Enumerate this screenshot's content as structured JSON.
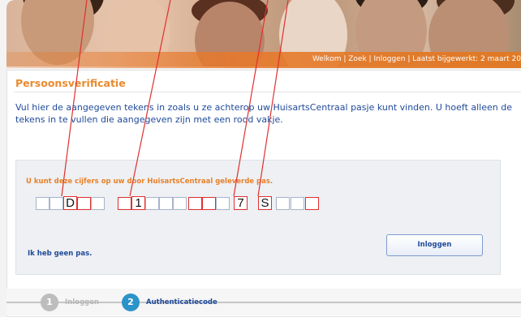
{
  "header": {
    "nav_text": "Welkom | Zoek | Inloggen | Laatst bijgewerkt: 2 maart 20"
  },
  "page": {
    "title": "Persoonsverificatie",
    "intro": "Vul hier de aangegeven tekens in zoals u ze achterop uw HuisartsCentraal pasje kunt vinden. U hoeft alleen de tekens in te vullen die aangegeven zijn met een rood vakje."
  },
  "form": {
    "instruction": "U kunt deze cijfers op uw door HuisartsCentraal geleverde pas.",
    "filled_characters": [
      "D",
      "1",
      "7",
      "S"
    ],
    "no_pass_link": "Ik heb geen pas.",
    "login_button": "Inloggen"
  },
  "steps": [
    {
      "number": "1",
      "label": "Inloggen",
      "state": "done"
    },
    {
      "number": "2",
      "label": "Authenticatiecode",
      "state": "active"
    }
  ],
  "colors": {
    "accent_orange": "#ea8a2e",
    "link_blue": "#1f4a9a",
    "marker_red": "#e03030",
    "step_active": "#2b93c9"
  }
}
